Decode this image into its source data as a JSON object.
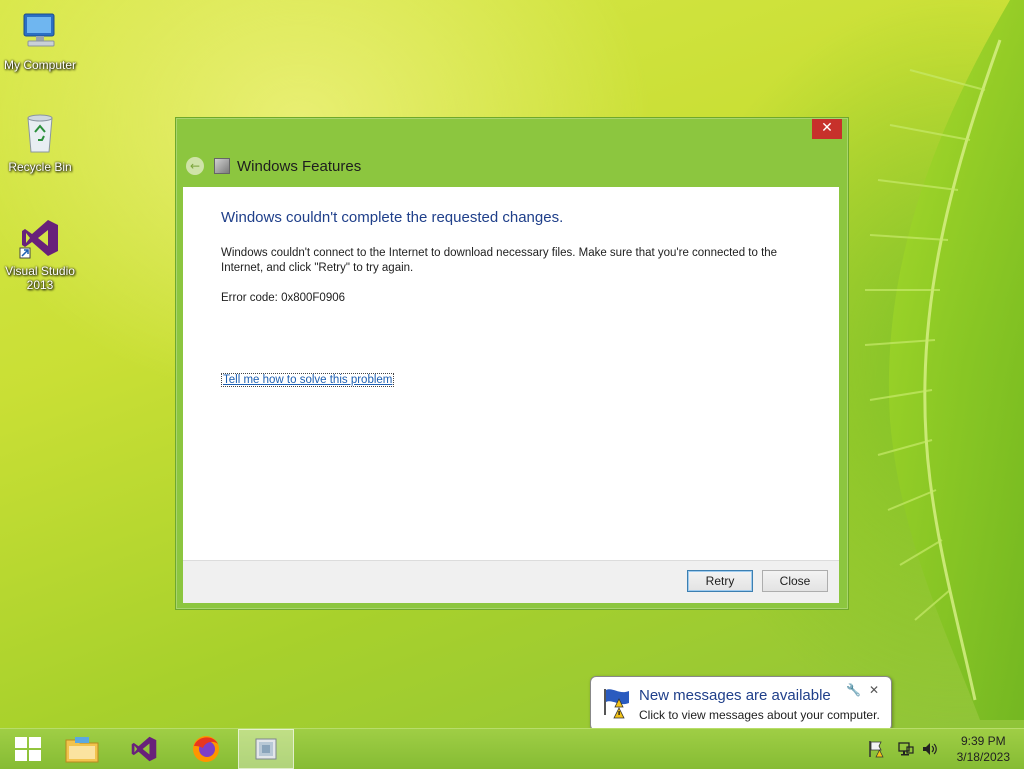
{
  "desktop": {
    "icons": [
      {
        "label": "My Computer",
        "icon": "computer-icon"
      },
      {
        "label": "Recycle Bin",
        "icon": "recycle-bin-icon"
      },
      {
        "label": "Visual Studio 2013",
        "icon": "visual-studio-icon"
      }
    ]
  },
  "dialog": {
    "title": "Windows Features",
    "heading": "Windows couldn't complete the requested changes.",
    "message": "Windows couldn't connect to the Internet to download necessary files. Make sure that you're connected to the Internet, and click \"Retry\" to try again.",
    "error_code": "Error code: 0x800F0906",
    "help_link": "Tell me how to solve this problem",
    "retry_label": "Retry",
    "close_label": "Close",
    "close_glyph": "✕"
  },
  "notification": {
    "title": "New messages are available",
    "text": "Click to view messages about your computer.",
    "close_glyph": "✕"
  },
  "taskbar": {
    "items": [
      "start-icon",
      "file-explorer-icon",
      "visual-studio-icon",
      "firefox-icon",
      "windows-features-icon"
    ],
    "time": "9:39 PM",
    "date": "3/18/2023"
  },
  "colors": {
    "accent_green": "#8cc63f",
    "close_red": "#c7312b",
    "heading_blue": "#1f3f8a",
    "link_blue": "#1d5fb2"
  }
}
